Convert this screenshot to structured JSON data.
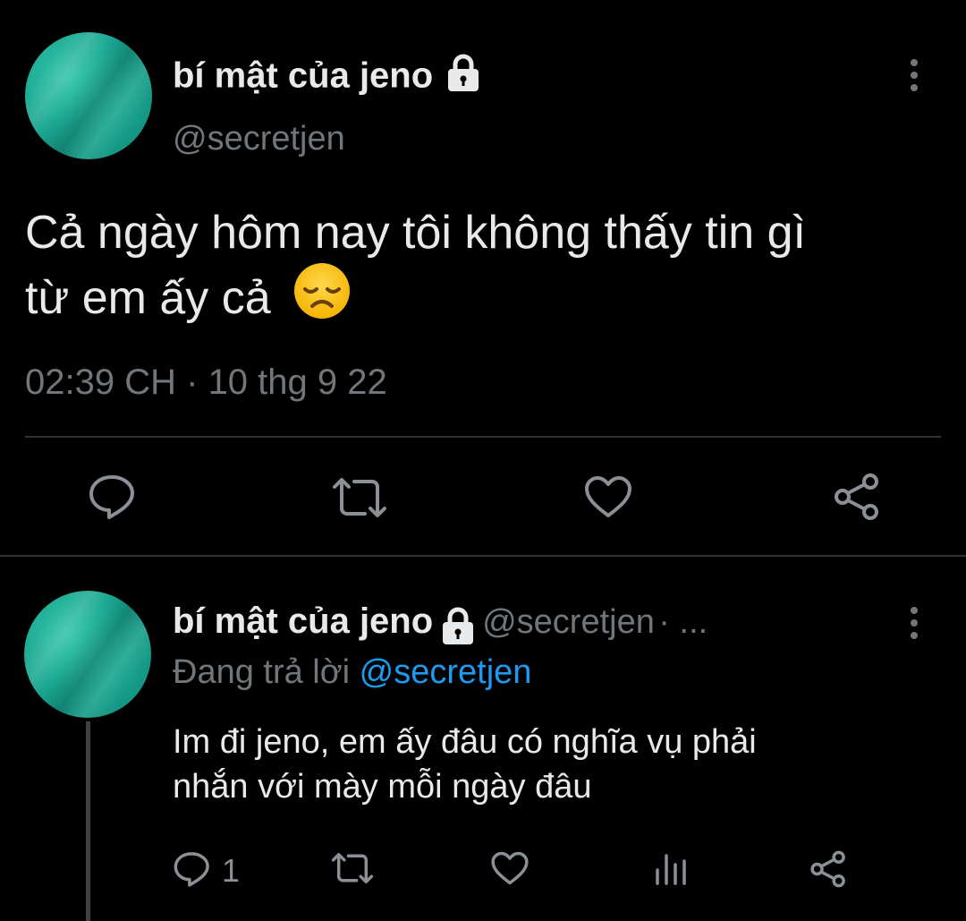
{
  "main_tweet": {
    "author_name": "bí mật của jeno",
    "author_handle": "@secretjen",
    "text_line1": "Cả ngày hôm nay tôi không thấy tin gì",
    "text_line2": "từ em ấy cả",
    "emoji": "disappointed-face-emoji",
    "time": "02:39 CH",
    "separator": "·",
    "date": "10 thg 9 22",
    "actions": [
      "reply-icon",
      "retweet-icon",
      "like-icon",
      "share-icon"
    ]
  },
  "reply_tweet": {
    "author_name": "bí mật của jeno",
    "author_handle": "@secretjen",
    "meta_suffix": "· ...",
    "replying_label": "Đang trả lời",
    "replying_to": "@secretjen",
    "text_line1": "Im đi jeno, em ấy đâu có nghĩa vụ phải",
    "text_line2": "nhắn với mày mỗi ngày đâu",
    "reply_count": "1",
    "actions": [
      "reply-icon",
      "retweet-icon",
      "like-icon",
      "views-icon",
      "share-icon"
    ]
  },
  "colors": {
    "background": "#000000",
    "text": "#e7e9ea",
    "secondary": "#71767b",
    "link": "#1d9bf0",
    "avatar": "#1aa893"
  }
}
